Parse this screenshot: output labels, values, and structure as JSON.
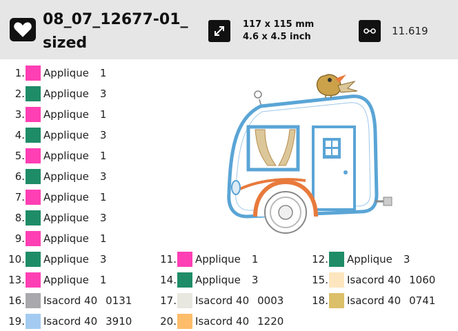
{
  "header": {
    "logo_icon": "heart-icon",
    "title_line1": "08_07_12677-01_",
    "title_line2": "sized",
    "size_icon": "expand-arrows-icon",
    "size_mm": "117 x 115 mm",
    "size_inch": "4.6 x 4.5 inch",
    "stitch_icon": "stitch-count-icon",
    "stitch_count": "11.619"
  },
  "colors": [
    {
      "num": "1.",
      "name": "Applique",
      "code": "1",
      "hex": "#ff3fb4"
    },
    {
      "num": "2.",
      "name": "Applique",
      "code": "3",
      "hex": "#1f8c68"
    },
    {
      "num": "3.",
      "name": "Applique",
      "code": "1",
      "hex": "#ff3fb4"
    },
    {
      "num": "4.",
      "name": "Applique",
      "code": "3",
      "hex": "#1f8c68"
    },
    {
      "num": "5.",
      "name": "Applique",
      "code": "1",
      "hex": "#ff3fb4"
    },
    {
      "num": "6.",
      "name": "Applique",
      "code": "3",
      "hex": "#1f8c68"
    },
    {
      "num": "7.",
      "name": "Applique",
      "code": "1",
      "hex": "#ff3fb4"
    },
    {
      "num": "8.",
      "name": "Applique",
      "code": "3",
      "hex": "#1f8c68"
    },
    {
      "num": "9.",
      "name": "Applique",
      "code": "1",
      "hex": "#ff3fb4"
    },
    {
      "num": "10.",
      "name": "Applique",
      "code": "3",
      "hex": "#1f8c68"
    },
    {
      "num": "11.",
      "name": "Applique",
      "code": "1",
      "hex": "#ff3fb4"
    },
    {
      "num": "12.",
      "name": "Applique",
      "code": "3",
      "hex": "#1f8c68"
    },
    {
      "num": "13.",
      "name": "Applique",
      "code": "1",
      "hex": "#ff3fb4"
    },
    {
      "num": "14.",
      "name": "Applique",
      "code": "3",
      "hex": "#1f8c68"
    },
    {
      "num": "15.",
      "name": "Isacord 40",
      "code": "1060",
      "hex": "#fde5bf"
    },
    {
      "num": "16.",
      "name": "Isacord 40",
      "code": "0131",
      "hex": "#a9a9ad"
    },
    {
      "num": "17.",
      "name": "Isacord 40",
      "code": "0003",
      "hex": "#e8e7e0"
    },
    {
      "num": "18.",
      "name": "Isacord 40",
      "code": "0741",
      "hex": "#dcbf69"
    },
    {
      "num": "19.",
      "name": "Isacord 40",
      "code": "3910",
      "hex": "#a3cbf1"
    },
    {
      "num": "20.",
      "name": "Isacord 40",
      "code": "1220",
      "hex": "#fdbd6b"
    }
  ],
  "artwork": {
    "icon": "camper-trailer-embroidery-icon",
    "body_outline": "#5aa5d6",
    "stripe": "#e87a3c",
    "bird": "#cba24a",
    "curtain": "#dcc79a"
  }
}
